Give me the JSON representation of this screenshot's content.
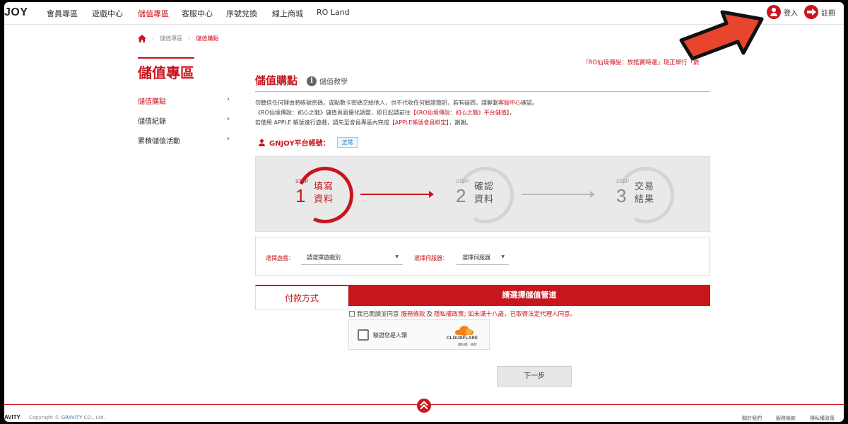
{
  "nav": {
    "logo": "JOY",
    "items": [
      "會員專區",
      "遊戲中心",
      "儲值專區",
      "客服中心",
      "序號兌換",
      "線上商城",
      "RO Land"
    ],
    "login": "登入",
    "register": "註冊"
  },
  "breadcrumb": [
    "儲值專區",
    "儲值購點"
  ],
  "sidebar": {
    "title": "儲值專區",
    "items": [
      "儲值購點",
      "儲值紀錄",
      "累積儲值活動"
    ]
  },
  "marquee": "『RO仙境傳說：放搖寶時運』現正舉行「數",
  "main": {
    "title": "儲值購點",
    "tutorial": "儲值教學",
    "notice1": "勿聽信任何理由將帳號密碼，或點數卡密碼交給他人，也不代收任何驗證簡訊，若有疑問，請聯繫",
    "notice1_link": "客服中心",
    "notice1_end": "確認。",
    "notice2": "《RO仙境傳說：初心之戰》儲值頁面優化調整，即日起請前往",
    "notice2_link": "【《RO仙境傳說：初心之戰》平台儲值】",
    "notice2_end": "，",
    "notice3": "若使用 APPLE 帳號進行遊戲，請先至會員專區內完成",
    "notice3_link": "【APPLE帳號會員綁定】",
    "notice3_end": "，謝謝。",
    "account_label": "GNJOY平台帳號：",
    "account_status": "正常"
  },
  "steps": [
    {
      "tag": "STEP",
      "num": "1",
      "line1": "填寫",
      "line2": "資料",
      "active": true
    },
    {
      "tag": "STEP",
      "num": "2",
      "line1": "確認",
      "line2": "資料",
      "active": false
    },
    {
      "tag": "STEP",
      "num": "3",
      "line1": "交易",
      "line2": "結果",
      "active": false
    }
  ],
  "selects": {
    "game_label": "選擇遊戲：",
    "game_value": "請選擇遊戲別",
    "server_label": "選擇伺服器：",
    "server_value": "選擇伺服器"
  },
  "payment": {
    "tab": "付款方式",
    "bar": "請選擇儲值管道",
    "agree_pre": "我已閱讀並同意",
    "agree_terms": "服務條款",
    "agree_and": "及",
    "agree_privacy": "隱私權政策",
    "agree_post": "; 如未滿十八歲，已取得法定代理人同意。"
  },
  "captcha": {
    "text": "驗證您是人類",
    "brand": "CLOUDFLARE",
    "links": "隱私權 · 條款"
  },
  "next_button": "下一步",
  "footer": {
    "brand": "AVITY",
    "copyright_pre": "Copyright",
    "copyright_link": "GRAVITY",
    "copyright_post": "CO., Ltd.",
    "links": [
      "關於我們",
      "服務條款",
      "隱私權政策"
    ]
  },
  "colors": {
    "accent": "#c8161d",
    "link_blue": "#3a78c2",
    "arrow": "#e8452e"
  }
}
